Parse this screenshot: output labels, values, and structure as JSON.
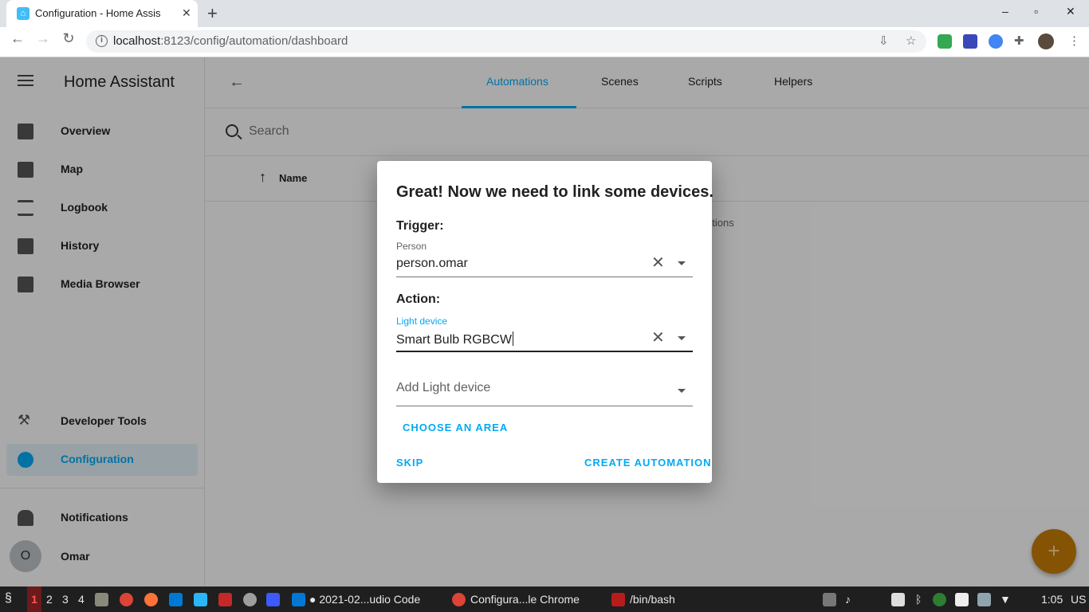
{
  "browser": {
    "tab_title": "Configuration - Home Assis",
    "url_host": "localhost",
    "url_path": ":8123/config/automation/dashboard",
    "window_controls": [
      "–",
      "▫",
      "✕"
    ]
  },
  "sidebar": {
    "title": "Home Assistant",
    "items": [
      {
        "label": "Overview",
        "icon": "dashboard-icon"
      },
      {
        "label": "Map",
        "icon": "map-icon"
      },
      {
        "label": "Logbook",
        "icon": "logbook-icon"
      },
      {
        "label": "History",
        "icon": "history-icon"
      },
      {
        "label": "Media Browser",
        "icon": "media-browser-icon"
      }
    ],
    "bottom_items": [
      {
        "label": "Developer Tools",
        "icon": "hammer-icon"
      },
      {
        "label": "Configuration",
        "icon": "gear-icon",
        "active": true
      }
    ],
    "notifications": "Notifications",
    "user_initial": "O",
    "user_name": "Omar"
  },
  "main": {
    "tabs": [
      "Automations",
      "Scenes",
      "Scripts",
      "Helpers"
    ],
    "active_tab": "Automations",
    "search_placeholder": "Search",
    "column_name": "Name",
    "empty_text_fragment": "ations",
    "fab_symbol": "+"
  },
  "dialog": {
    "title": "Great! Now we need to link some devices.",
    "trigger_label": "Trigger:",
    "trigger_field_label": "Person",
    "trigger_value": "person.omar",
    "action_label": "Action:",
    "action_field_label": "Light device",
    "action_value": "Smart Bulb RGBCW",
    "add_placeholder": "Add Light device",
    "choose_area": "CHOOSE AN AREA",
    "skip": "SKIP",
    "create": "CREATE AUTOMATION"
  },
  "taskbar": {
    "workspaces": [
      "1",
      "2",
      "3",
      "4"
    ],
    "windows": [
      "2021-02...udio Code",
      "Configura...le Chrome",
      "/bin/bash"
    ],
    "clock": "1:05",
    "locale": "US"
  },
  "colors": {
    "accent": "#03a9f4",
    "fab": "#c47b06"
  }
}
